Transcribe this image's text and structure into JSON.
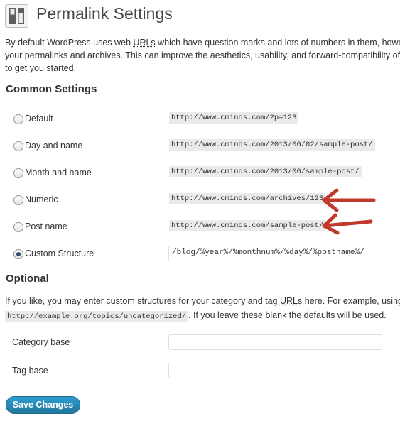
{
  "page": {
    "title": "Permalink Settings",
    "icon": "settings-sliders-icon",
    "intro_line1_pre": "By default WordPress uses web ",
    "intro_line1_abbr": "URLs",
    "intro_line1_post": " which have question marks and lots of numbers in them, howe",
    "intro_line2": "your permalinks and archives. This can improve the aesthetics, usability, and forward-compatibility of y",
    "intro_line3": "to get you started."
  },
  "common": {
    "heading": "Common Settings",
    "options": [
      {
        "label": "Default",
        "example": "http://www.cminds.com/?p=123",
        "checked": false
      },
      {
        "label": "Day and name",
        "example": "http://www.cminds.com/2013/06/02/sample-post/",
        "checked": false
      },
      {
        "label": "Month and name",
        "example": "http://www.cminds.com/2013/06/sample-post/",
        "checked": false
      },
      {
        "label": "Numeric",
        "example": "http://www.cminds.com/archives/123",
        "checked": false
      },
      {
        "label": "Post name",
        "example": "http://www.cminds.com/sample-post/",
        "checked": false
      },
      {
        "label": "Custom Structure",
        "value": "/blog/%year%/%monthnum%/%day%/%postname%/",
        "checked": true
      }
    ]
  },
  "optional": {
    "heading": "Optional",
    "text_pre": "If you like, you may enter custom structures for your category and tag ",
    "text_abbr": "URLs",
    "text_post": " here. For example, using ",
    "text_code_cut": "t",
    "code_example": "http://example.org/topics/uncategorized/",
    "text_after_code": ". If you leave these blank the defaults will be used.",
    "category_base_label": "Category base",
    "category_base_value": "",
    "tag_base_label": "Tag base",
    "tag_base_value": ""
  },
  "actions": {
    "save_label": "Save Changes"
  },
  "colors": {
    "arrow": "#c0392b",
    "button": "#21759b"
  }
}
